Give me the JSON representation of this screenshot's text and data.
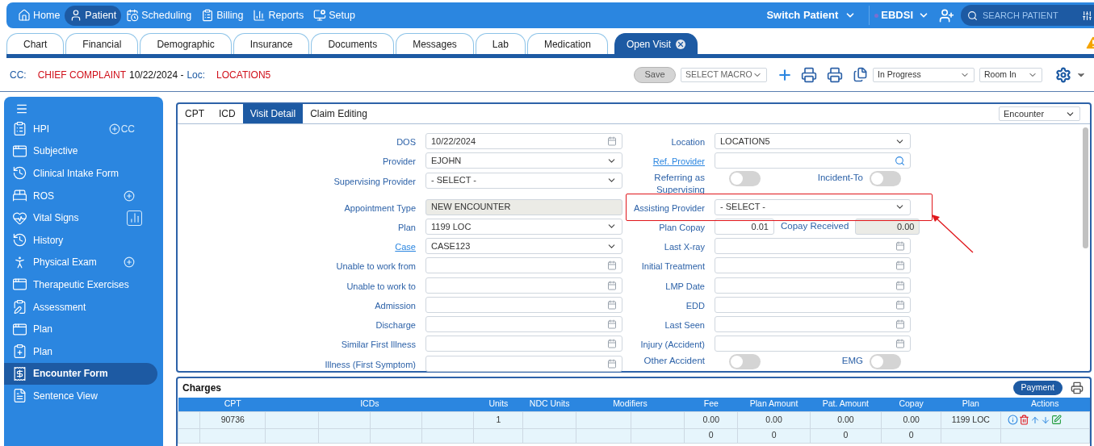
{
  "nav": {
    "items": [
      {
        "label": "Home",
        "selected": false
      },
      {
        "label": "Patient",
        "selected": true
      },
      {
        "label": "Scheduling",
        "selected": false
      },
      {
        "label": "Billing",
        "selected": false
      },
      {
        "label": "Reports",
        "selected": false
      },
      {
        "label": "Setup",
        "selected": false
      }
    ],
    "switch_patient": "Switch Patient",
    "user": "EBDSI",
    "search": {
      "placeholder": "SEARCH PATIENT"
    }
  },
  "tabs": [
    {
      "label": "Chart",
      "selected": false,
      "closable": false
    },
    {
      "label": "Financial",
      "selected": false,
      "closable": false
    },
    {
      "label": "Demographic",
      "selected": false,
      "closable": false
    },
    {
      "label": "Insurance",
      "selected": false,
      "closable": false
    },
    {
      "label": "Documents",
      "selected": false,
      "closable": false
    },
    {
      "label": "Messages",
      "selected": false,
      "closable": false
    },
    {
      "label": "Lab",
      "selected": false,
      "closable": false
    },
    {
      "label": "Medication",
      "selected": false,
      "closable": false
    },
    {
      "label": "Open Visit",
      "selected": true,
      "closable": true
    }
  ],
  "visit_header": {
    "cc_label": "CC:",
    "complaint": "CHIEF COMPLAINT",
    "date": "10/22/2024 -",
    "loc_label": "Loc:",
    "location": "LOCATION5"
  },
  "toolbar": {
    "save": {
      "label": "Save",
      "disabled": true
    },
    "macro": {
      "placeholder": "SELECT MACRO"
    },
    "status": {
      "value": "In Progress"
    },
    "room": {
      "value": "Room In"
    }
  },
  "sidebar": {
    "items": [
      {
        "label": "HPI",
        "selected": false,
        "accessory": {
          "kind": "add",
          "label": "CC"
        }
      },
      {
        "label": "Subjective",
        "selected": false
      },
      {
        "label": "Clinical Intake Form",
        "selected": false
      },
      {
        "label": "ROS",
        "selected": false,
        "accessory": {
          "kind": "add"
        }
      },
      {
        "label": "Vital Signs",
        "selected": false,
        "accessory": {
          "kind": "chart"
        }
      },
      {
        "label": "History",
        "selected": false
      },
      {
        "label": "Physical Exam",
        "selected": false,
        "accessory": {
          "kind": "add"
        }
      },
      {
        "label": "Therapeutic Exercises",
        "selected": false
      },
      {
        "label": "Assessment",
        "selected": false
      },
      {
        "label": "Plan",
        "selected": false
      },
      {
        "label": "Plan",
        "selected": false
      },
      {
        "label": "Encounter Form",
        "selected": true
      },
      {
        "label": "Sentence View",
        "selected": false
      }
    ]
  },
  "detail_tabs": [
    {
      "label": "CPT",
      "selected": false
    },
    {
      "label": "ICD",
      "selected": false
    },
    {
      "label": "Visit Detail",
      "selected": true
    },
    {
      "label": "Claim Editing",
      "selected": false
    }
  ],
  "view_select": {
    "value": "Encounter"
  },
  "form_rows": [
    {
      "left": {
        "kind": "date",
        "label": "DOS",
        "value": "10/22/2024"
      },
      "right": {
        "kind": "select",
        "label": "Location",
        "value": "LOCATION5"
      }
    },
    {
      "left": {
        "kind": "select",
        "label": "Provider",
        "value": "EJOHN"
      },
      "right": {
        "kind": "search",
        "label": "Ref. Provider",
        "link": true
      }
    },
    {
      "left": {
        "kind": "select",
        "label": "Supervising Provider",
        "value": "- SELECT -"
      },
      "right": {
        "kind": "toggle_pair",
        "items": [
          {
            "label": "Referring as Supervising",
            "on": false
          },
          {
            "label": "Incident-To",
            "on": false
          }
        ]
      }
    },
    {
      "left": {
        "kind": "readonly",
        "label": "Appointment Type",
        "value": "NEW ENCOUNTER"
      },
      "right": {
        "kind": "select",
        "label": "Assisting Provider",
        "value": "- SELECT -",
        "highlighted": true
      }
    },
    {
      "left": {
        "kind": "select",
        "label": "Plan",
        "value": "1199 LOC"
      },
      "right": {
        "kind": "amount_pair",
        "items": [
          {
            "label": "Plan Copay",
            "value": "0.01",
            "readonly": false
          },
          {
            "label": "Copay Received",
            "value": "0.00",
            "readonly": true
          }
        ]
      }
    },
    {
      "left": {
        "kind": "select",
        "label": "Case",
        "value": "CASE123",
        "link": true
      },
      "right": {
        "kind": "date",
        "label": "Last X-ray"
      }
    },
    {
      "left": {
        "kind": "date",
        "label": "Unable to work from"
      },
      "right": {
        "kind": "date",
        "label": "Initial Treatment"
      }
    },
    {
      "left": {
        "kind": "date",
        "label": "Unable to work to"
      },
      "right": {
        "kind": "date",
        "label": "LMP Date"
      }
    },
    {
      "left": {
        "kind": "date",
        "label": "Admission"
      },
      "right": {
        "kind": "date",
        "label": "EDD"
      }
    },
    {
      "left": {
        "kind": "date",
        "label": "Discharge"
      },
      "right": {
        "kind": "date",
        "label": "Last Seen"
      }
    },
    {
      "left": {
        "kind": "date",
        "label": "Similar First Illness"
      },
      "right": {
        "kind": "date",
        "label": "Injury (Accident)"
      }
    },
    {
      "left": {
        "kind": "date",
        "label": "Illness (First Symptom)"
      },
      "right": {
        "kind": "toggle_pair",
        "items": [
          {
            "label": "Other Accident",
            "on": false
          },
          {
            "label": "EMG",
            "on": false
          }
        ]
      }
    }
  ],
  "charges": {
    "title": "Charges",
    "payment_button": "Payment",
    "columns": [
      "CPT",
      "ICDs",
      "Units",
      "NDC Units",
      "Modifiers",
      "Fee",
      "Plan Amount",
      "Pat. Amount",
      "Copay",
      "Plan",
      "Actions"
    ],
    "rows": [
      {
        "cpt": "90736",
        "units": "1",
        "fee": "0.00",
        "plan_amount": "0.00",
        "pat_amount": "0.00",
        "copay": "0.00",
        "plan": "1199 LOC",
        "actions": true
      },
      {
        "fee": "0",
        "plan_amount": "0",
        "pat_amount": "0",
        "copay": "0",
        "actions": false
      }
    ]
  }
}
